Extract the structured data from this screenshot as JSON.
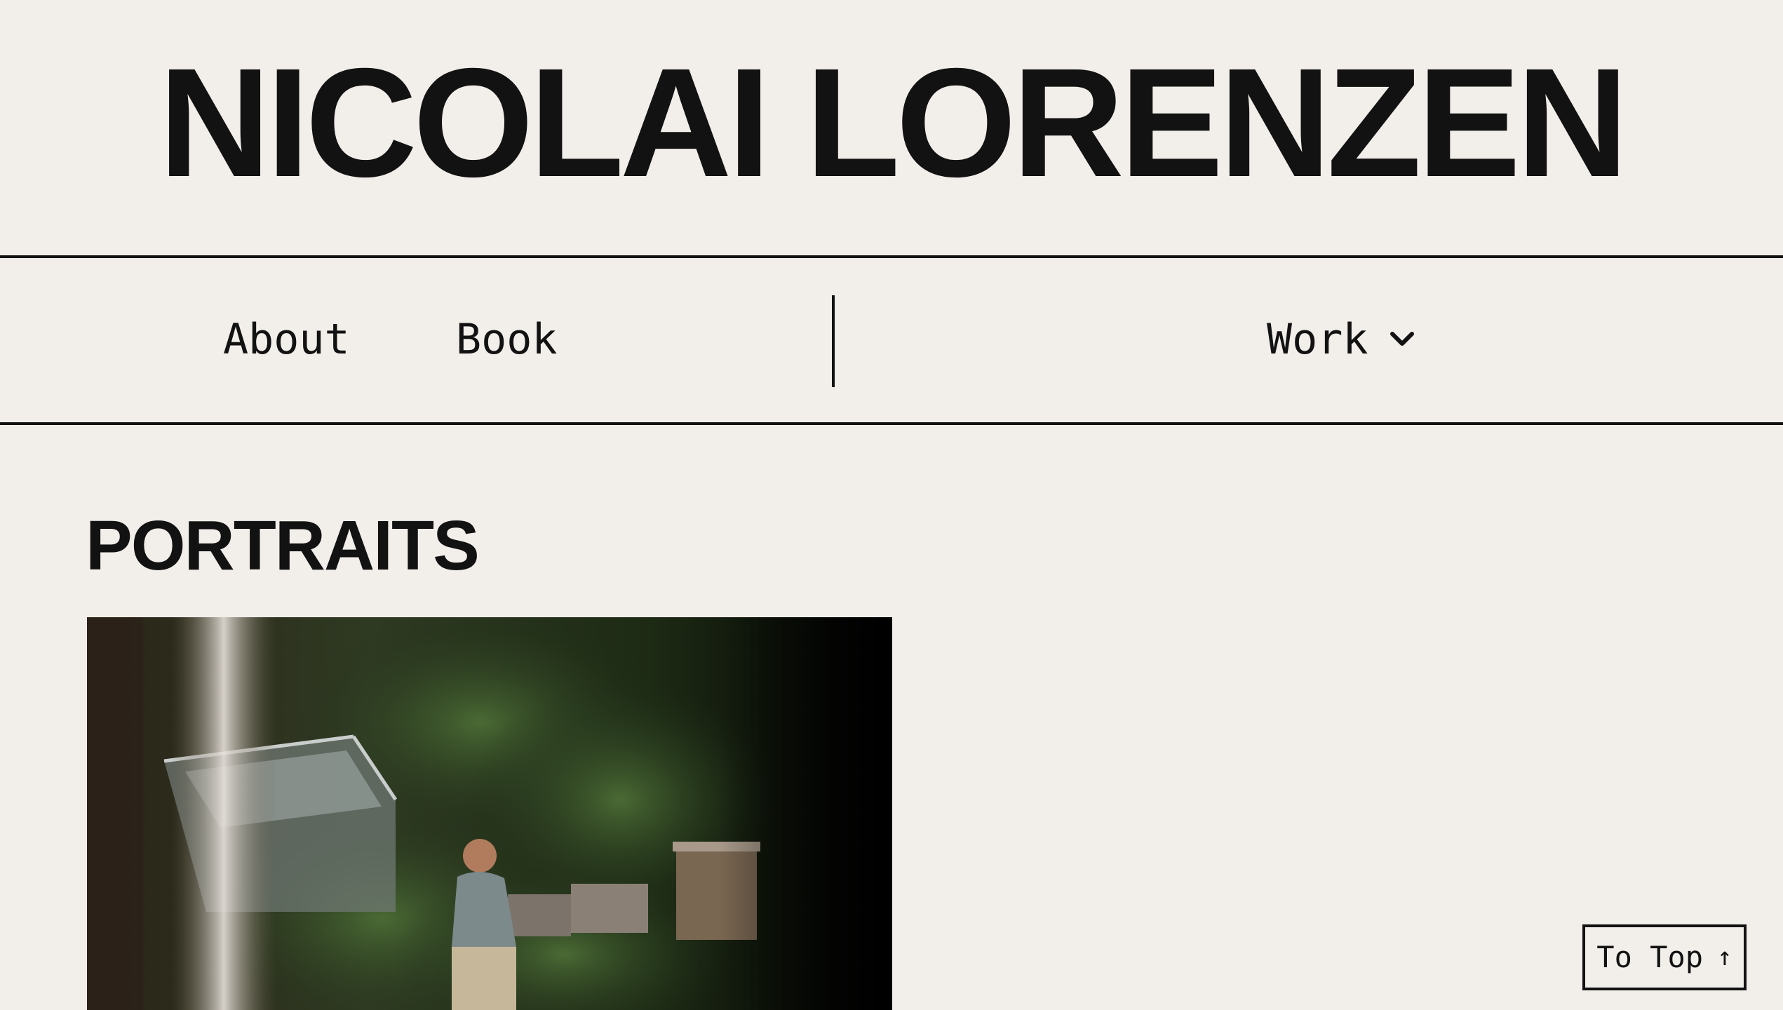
{
  "site": {
    "title": "NICOLAI LORENZEN"
  },
  "nav": {
    "about_label": "About",
    "book_label": "Book",
    "work_label": "Work",
    "work_icon": "chevron-down-icon"
  },
  "main": {
    "section_title": "PORTRAITS",
    "photo_alt": "Portrait of a man in a sweater walking through a lush garden with a greenhouse and beehives"
  },
  "to_top": {
    "label": "To Top",
    "arrow": "↑"
  },
  "colors": {
    "background": "#f2eeea",
    "text": "#121212"
  }
}
